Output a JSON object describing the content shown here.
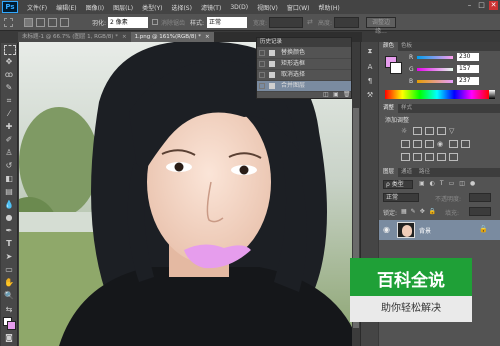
{
  "app": {
    "logo": "Ps",
    "accent": "#31a8ff"
  },
  "menu": [
    "文件(F)",
    "编辑(E)",
    "图像(I)",
    "图层(L)",
    "类型(Y)",
    "选择(S)",
    "滤镜(T)",
    "3D(D)",
    "视图(V)",
    "窗口(W)",
    "帮助(H)"
  ],
  "window_controls": {
    "minimize": "–",
    "maximize": "□",
    "close": "✕"
  },
  "options": {
    "feather_label": "羽化:",
    "feather_value": "2 像素",
    "antialias_label": "消除锯齿",
    "style_label": "样式:",
    "style_value": "正常",
    "width_label": "宽度:",
    "height_label": "高度:",
    "refine_button": "调整边缘..."
  },
  "tabs": [
    {
      "label": "未标题-1 @ 66.7% (图层 1, RGB/8) *",
      "close": "×",
      "active": false
    },
    {
      "label": "1.png @ 161%(RGB/8) *",
      "close": "×",
      "active": true
    }
  ],
  "history": {
    "title": "历史记录",
    "items": [
      {
        "label": "替换颜色",
        "selected": false
      },
      {
        "label": "矩形选框",
        "selected": false
      },
      {
        "label": "取消选择",
        "selected": false
      },
      {
        "label": "合并图层",
        "selected": true
      }
    ]
  },
  "color_panel": {
    "tabs": [
      "颜色",
      "色板"
    ],
    "channels": [
      {
        "label": "R",
        "value": "230"
      },
      {
        "label": "G",
        "value": "157"
      },
      {
        "label": "B",
        "value": "237"
      }
    ],
    "fg_color": "#e69ded"
  },
  "adjustments_panel": {
    "tabs": [
      "调整",
      "样式"
    ],
    "heading": "添加调整"
  },
  "layers_panel": {
    "tabs": [
      "图层",
      "通道",
      "路径"
    ],
    "filter_label": "ρ 类型",
    "blend_mode": "正常",
    "opacity_label": "不透明度:",
    "lock_label": "锁定:",
    "fill_label": "填充:",
    "layer_name": "背景"
  },
  "watermark": {
    "title": "百科全说",
    "subtitle": "助你轻松解决"
  }
}
